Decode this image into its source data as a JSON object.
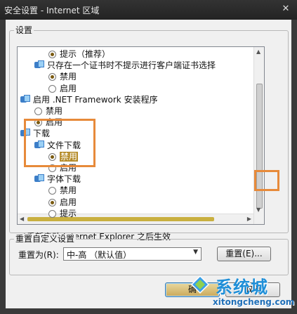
{
  "window": {
    "title": "安全设置 - Internet 区域",
    "close_glyph": "✕"
  },
  "settings_group": {
    "label": "设置"
  },
  "tree": [
    {
      "kind": "radio",
      "indent": 2,
      "selected": true,
      "label": "提示（推荐）"
    },
    {
      "kind": "folder",
      "indent": 1,
      "label": "只存在一个证书时不提示进行客户端证书选择"
    },
    {
      "kind": "radio",
      "indent": 2,
      "selected": true,
      "label": "禁用"
    },
    {
      "kind": "radio",
      "indent": 2,
      "selected": false,
      "label": "启用"
    },
    {
      "kind": "folder",
      "indent": 0,
      "label": "启用 .NET Framework 安装程序"
    },
    {
      "kind": "radio",
      "indent": 1,
      "selected": false,
      "label": "禁用"
    },
    {
      "kind": "radio",
      "indent": 1,
      "selected": true,
      "label": "启用"
    },
    {
      "kind": "folder",
      "indent": 0,
      "label": "下载"
    },
    {
      "kind": "folder",
      "indent": 1,
      "label": "文件下载"
    },
    {
      "kind": "radio",
      "indent": 2,
      "selected": true,
      "highlight": true,
      "label": "禁用"
    },
    {
      "kind": "radio",
      "indent": 2,
      "selected": false,
      "label": "启用"
    },
    {
      "kind": "folder",
      "indent": 1,
      "label": "字体下载"
    },
    {
      "kind": "radio",
      "indent": 2,
      "selected": false,
      "label": "禁用"
    },
    {
      "kind": "radio",
      "indent": 2,
      "selected": true,
      "label": "启用"
    },
    {
      "kind": "radio",
      "indent": 2,
      "selected": false,
      "label": "提示"
    }
  ],
  "restart_note": "*重新启动 Internet Explorer 之后生效",
  "reset_group": {
    "label": "重置自定义设置",
    "reset_to_label": "重置为(R):",
    "reset_to_value": "中-高 （默认值）",
    "reset_button": "重置(E)..."
  },
  "buttons": {
    "ok": "确",
    "cancel": "取消"
  },
  "watermark": {
    "brand": "系统城",
    "url": "xitongcheng.com"
  },
  "colors": {
    "accent": "#e78a3a",
    "selection": "#b68d2b"
  }
}
